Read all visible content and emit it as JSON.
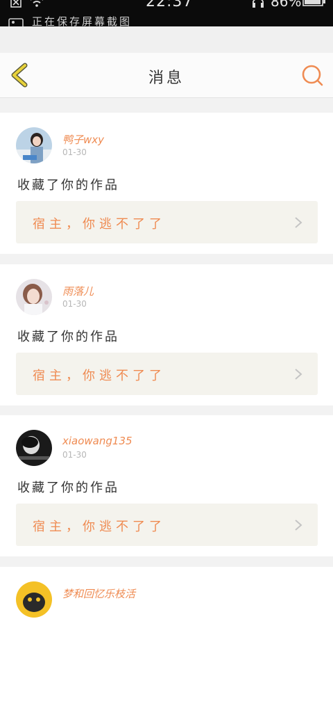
{
  "status_bar": {
    "time": "22:37",
    "battery": "86%",
    "notification": "正在保存屏幕截图"
  },
  "header": {
    "title": "消息",
    "back_icon": "chevron-left-icon",
    "search_icon": "search-icon"
  },
  "colors": {
    "accent": "#ef8b52",
    "back_arrow": "#e8d23b",
    "card_bg": "#ffffff",
    "work_bg": "#f4f3ed",
    "page_bg": "#f2f2f2"
  },
  "messages": [
    {
      "user": "鸭子wxy",
      "date": "01-30",
      "action": "收藏了你的作品",
      "work": "宿主，你逃不了了"
    },
    {
      "user": "雨落儿",
      "date": "01-30",
      "action": "收藏了你的作品",
      "work": "宿主，你逃不了了"
    },
    {
      "user": "xiaowang135",
      "date": "01-30",
      "action": "收藏了你的作品",
      "work": "宿主，你逃不了了"
    },
    {
      "user": "梦和回忆乐枝活",
      "date": "",
      "action": "",
      "work": ""
    }
  ]
}
